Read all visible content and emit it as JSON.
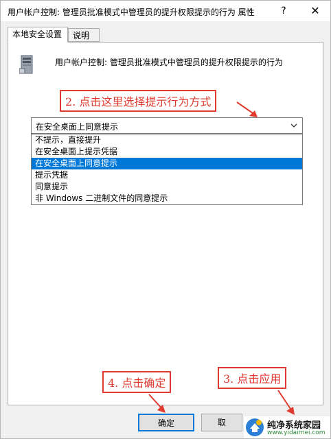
{
  "window": {
    "title": "用户帐户控制: 管理员批准模式中管理员的提升权限提示的行为 属性",
    "help_glyph": "?",
    "close_glyph": "✕"
  },
  "tabs": [
    {
      "label": "本地安全设置",
      "active": true
    },
    {
      "label": "说明",
      "active": false
    }
  ],
  "policy": {
    "icon": "policy-computer-icon",
    "name": "用户帐户控制: 管理员批准模式中管理员的提升权限提示的行为"
  },
  "select": {
    "value": "在安全桌面上同意提示",
    "chevron_icon": "chevron-down-icon",
    "options": [
      {
        "label": "不提示，直接提升",
        "selected": false
      },
      {
        "label": "在安全桌面上提示凭据",
        "selected": false
      },
      {
        "label": "在安全桌面上同意提示",
        "selected": true
      },
      {
        "label": "提示凭据",
        "selected": false
      },
      {
        "label": "同意提示",
        "selected": false
      },
      {
        "label": "非 Windows 二进制文件的同意提示",
        "selected": false
      }
    ]
  },
  "annotations": {
    "step2": "2. 点击这里选择提示行为方式",
    "step4": "4. 点击确定",
    "step3": "3. 点击应用",
    "color": "#e03a2e"
  },
  "buttons": {
    "ok": "确定",
    "cancel": "取"
  },
  "watermark": {
    "title": "纯净系统家园",
    "url": "www.yidaimei.com"
  },
  "colors": {
    "accent": "#0078d7",
    "annotation": "#e03a2e"
  }
}
